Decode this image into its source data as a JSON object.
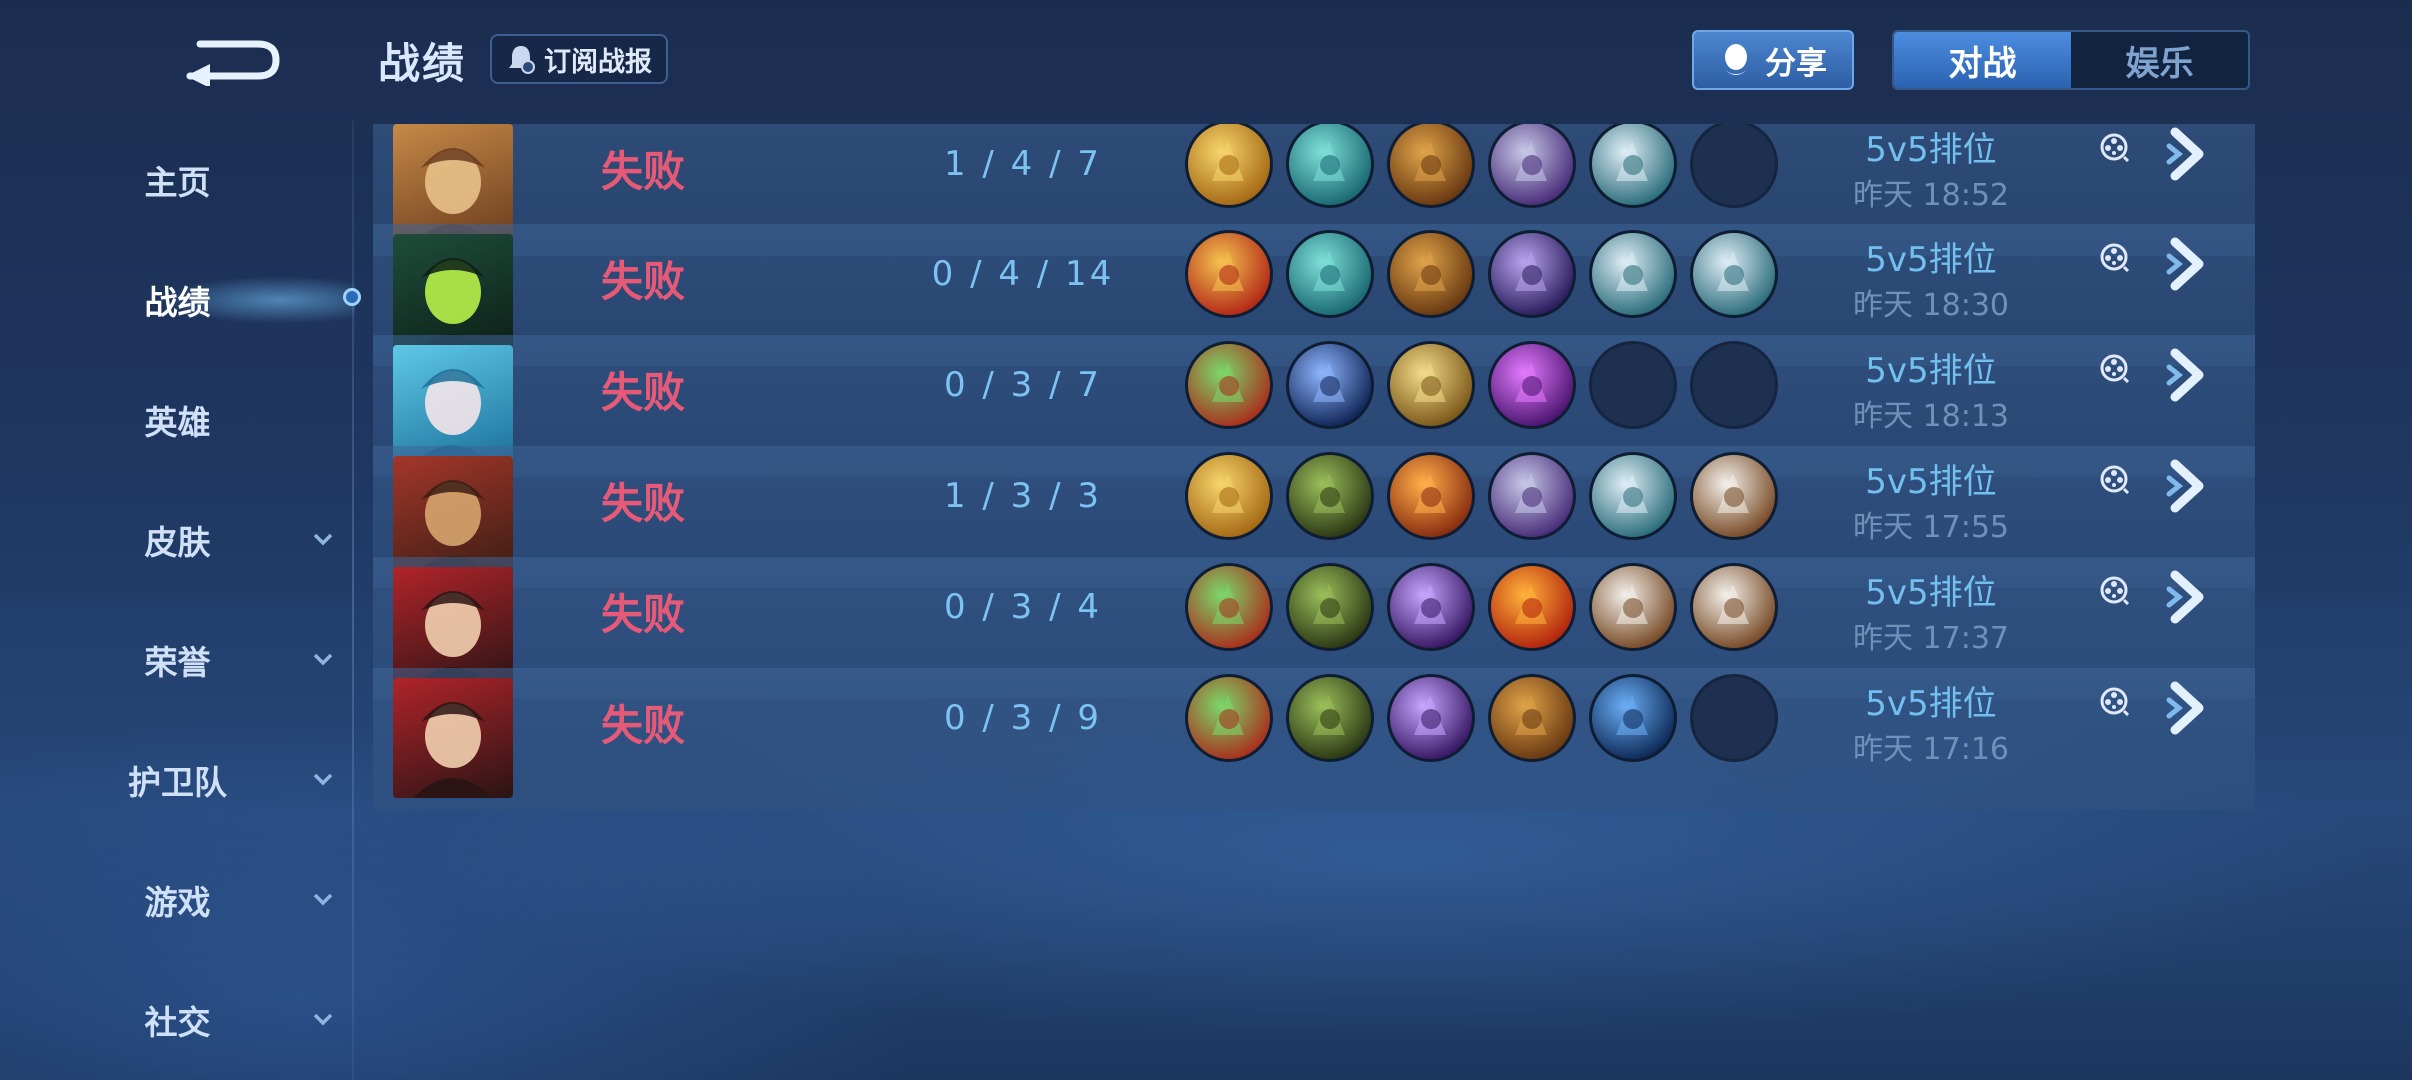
{
  "header": {
    "title": "战绩",
    "subscribe_label": "订阅战报",
    "share_label": "分享",
    "tabs": [
      {
        "label": "对战",
        "active": true
      },
      {
        "label": "娱乐",
        "active": false
      }
    ]
  },
  "sidebar": {
    "items": [
      {
        "label": "主页",
        "has_chevron": false,
        "active": false
      },
      {
        "label": "战绩",
        "has_chevron": false,
        "active": true
      },
      {
        "label": "英雄",
        "has_chevron": false,
        "active": false
      },
      {
        "label": "皮肤",
        "has_chevron": true,
        "active": false
      },
      {
        "label": "荣誉",
        "has_chevron": true,
        "active": false
      },
      {
        "label": "护卫队",
        "has_chevron": true,
        "active": false
      },
      {
        "label": "游戏",
        "has_chevron": true,
        "active": false
      },
      {
        "label": "社交",
        "has_chevron": true,
        "active": false
      }
    ]
  },
  "colors": {
    "defeat": "#e65a78",
    "kda": "#7cc2f2",
    "accent_blue": "#3b78c8",
    "background": "#1f3762"
  },
  "matches": [
    {
      "hero": "bronze-warrior",
      "result": "失败",
      "kda": "1 / 4 / 7",
      "mode": "5v5排位",
      "time": "昨天 18:52",
      "items": [
        "golden-gauntlet",
        "teal-boots",
        "bronze-armor",
        "violet-mask",
        "silver-bracer",
        "empty"
      ]
    },
    {
      "hero": "green-hooded-mage",
      "result": "失败",
      "kda": "0 / 4 / 14",
      "mode": "5v5排位",
      "time": "昨天 18:30",
      "items": [
        "red-gold-gauntlet",
        "teal-boots",
        "bronze-armor",
        "violet-helm",
        "silver-bracer",
        "silver-bracer"
      ]
    },
    {
      "hero": "water-fairy",
      "result": "失败",
      "kda": "0 / 3 / 7",
      "mode": "5v5排位",
      "time": "昨天 18:13",
      "items": [
        "green-scroll",
        "blue-boots",
        "gold-helm",
        "purple-staff",
        "empty",
        "empty"
      ]
    },
    {
      "hero": "red-helmet-general",
      "result": "失败",
      "kda": "1 / 3 / 3",
      "mode": "5v5排位",
      "time": "昨天 17:55",
      "items": [
        "golden-gauntlet",
        "green-boots",
        "orange-hammer",
        "violet-mask",
        "silver-bracer",
        "leather-vest"
      ]
    },
    {
      "hero": "crimson-swordsman",
      "result": "失败",
      "kda": "0 / 3 / 4",
      "mode": "5v5排位",
      "time": "昨天 17:37",
      "items": [
        "green-scroll",
        "green-boots",
        "purple-claw",
        "fire-orb",
        "leather-vest",
        "leather-vest"
      ]
    },
    {
      "hero": "crimson-swordsman",
      "result": "失败",
      "kda": "0 / 3 / 9",
      "mode": "5v5排位",
      "time": "昨天 17:16",
      "items": [
        "green-scroll",
        "green-boots",
        "purple-claw",
        "bronze-armor",
        "blue-hood",
        "empty"
      ]
    }
  ]
}
